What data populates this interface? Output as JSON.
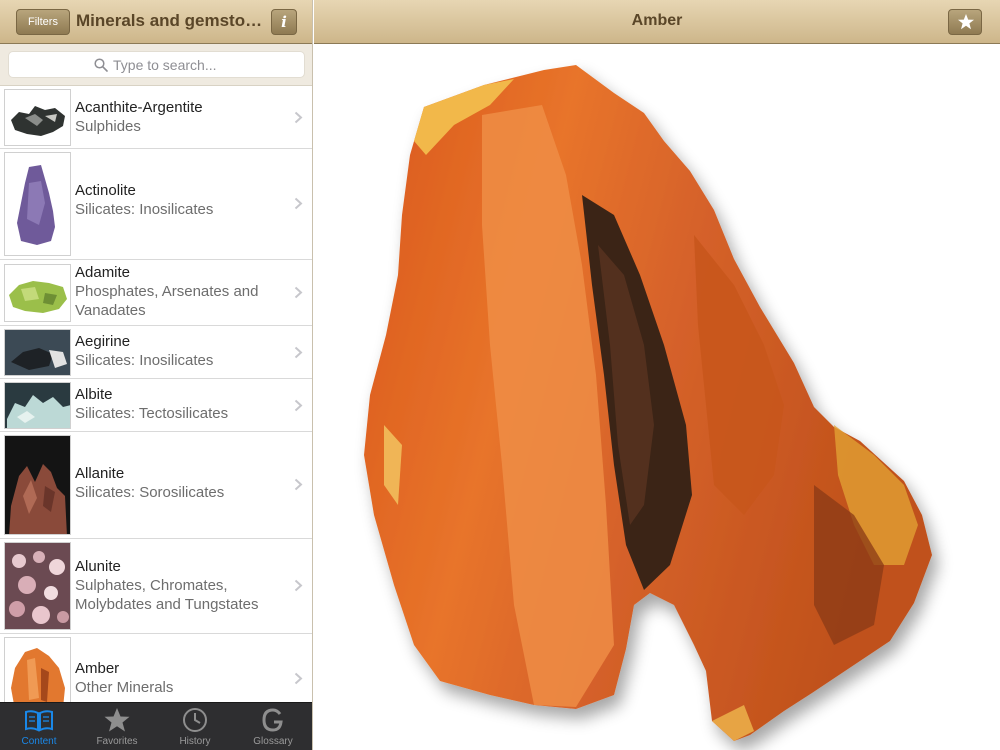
{
  "left_header": {
    "filters_label": "Filters",
    "title": "Minerals and gemstones",
    "info_label": "i"
  },
  "search": {
    "placeholder": "Type to search..."
  },
  "minerals": [
    {
      "name": "Acanthite-Argentite",
      "category": "Sulphides"
    },
    {
      "name": "Actinolite",
      "category": "Silicates: Inosilicates"
    },
    {
      "name": "Adamite",
      "category": "Phosphates, Arsenates and Vanadates"
    },
    {
      "name": "Aegirine",
      "category": "Silicates: Inosilicates"
    },
    {
      "name": "Albite",
      "category": "Silicates: Tectosilicates"
    },
    {
      "name": "Allanite",
      "category": "Silicates: Sorosilicates"
    },
    {
      "name": "Alunite",
      "category": "Sulphates, Chromates, Molybdates and Tungstates"
    },
    {
      "name": "Amber",
      "category": "Other Minerals"
    }
  ],
  "tabs": [
    {
      "label": "Content",
      "icon": "book-icon",
      "active": true
    },
    {
      "label": "Favorites",
      "icon": "star-icon"
    },
    {
      "label": "History",
      "icon": "clock-icon"
    },
    {
      "label": "Glossary",
      "icon": "glossary-g-icon"
    }
  ],
  "detail": {
    "title": "Amber"
  },
  "colors": {
    "header_tan": "#d9c59e",
    "header_text": "#5a4628",
    "tabbar": "#2e2e30",
    "tab_active": "#1a88e8",
    "amber_orange": "#e8742a"
  }
}
